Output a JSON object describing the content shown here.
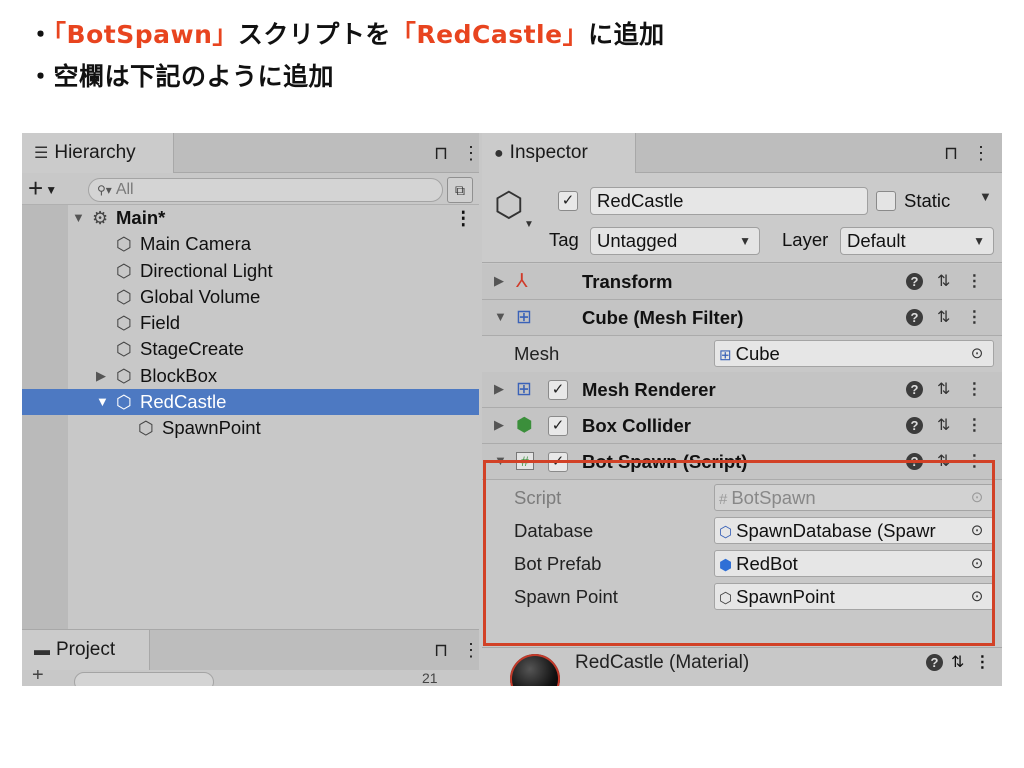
{
  "instructions": {
    "line1": {
      "bullet": "・",
      "part1": "「BotSpawn」",
      "part2": "スクリプトを",
      "part3": "「RedCastle」",
      "part4": "に追加"
    },
    "line2": {
      "bullet": "・",
      "text": "空欄は下記のように追加"
    },
    "highlight_color": "#e8441f"
  },
  "hierarchy": {
    "tab_icon": "list-icon",
    "tab_label": "Hierarchy",
    "lock_glyph": "⊓",
    "menu_glyph": "⋮",
    "add_glyph": "+",
    "search_placeholder": "All",
    "items": [
      {
        "label": "Main*",
        "indent": 0,
        "expanded": true,
        "icon": "unity-scene-icon",
        "bold": true,
        "selected": false
      },
      {
        "label": "Main Camera",
        "indent": 1,
        "icon": "cube-icon",
        "selected": false
      },
      {
        "label": "Directional Light",
        "indent": 1,
        "icon": "cube-icon",
        "selected": false
      },
      {
        "label": "Global Volume",
        "indent": 1,
        "icon": "cube-icon",
        "selected": false
      },
      {
        "label": "Field",
        "indent": 1,
        "icon": "cube-icon",
        "selected": false
      },
      {
        "label": "StageCreate",
        "indent": 1,
        "icon": "cube-icon",
        "selected": false
      },
      {
        "label": "BlockBox",
        "indent": 1,
        "collapsed": true,
        "icon": "cube-icon",
        "selected": false
      },
      {
        "label": "RedCastle",
        "indent": 1,
        "expanded": true,
        "icon": "cube-icon",
        "selected": true
      },
      {
        "label": "SpawnPoint",
        "indent": 2,
        "icon": "cube-icon",
        "selected": false
      }
    ],
    "selection_color": "#4d79c2"
  },
  "project": {
    "tab_label": "Project",
    "tab_icon": "folder-icon",
    "count": "21"
  },
  "inspector": {
    "tab_label": "Inspector",
    "tab_icon": "info-icon",
    "object_name": "RedCastle",
    "active": true,
    "static_label": "Static",
    "static_checked": false,
    "tag_label": "Tag",
    "tag_value": "Untagged",
    "layer_label": "Layer",
    "layer_value": "Default",
    "components": [
      {
        "title": "Transform",
        "expanded": false,
        "icon": "transform-icon",
        "has_checkbox": false
      },
      {
        "title": "Cube (Mesh Filter)",
        "expanded": true,
        "icon": "mesh-filter-icon",
        "has_checkbox": false,
        "properties": [
          {
            "label": "Mesh",
            "value": "Cube",
            "icon": "mesh-icon"
          }
        ]
      },
      {
        "title": "Mesh Renderer",
        "expanded": false,
        "icon": "mesh-renderer-icon",
        "has_checkbox": true,
        "checked": true
      },
      {
        "title": "Box Collider",
        "expanded": false,
        "icon": "box-collider-icon",
        "has_checkbox": true,
        "checked": true
      },
      {
        "title": "Bot Spawn (Script)",
        "expanded": true,
        "icon": "script-icon",
        "has_checkbox": true,
        "checked": true,
        "properties": [
          {
            "label": "Script",
            "value": "BotSpawn",
            "icon": "script-icon",
            "disabled": true
          },
          {
            "label": "Database",
            "value": "SpawnDatabase (Spawr",
            "icon": "scriptable-object-icon"
          },
          {
            "label": "Bot Prefab",
            "value": "RedBot",
            "icon": "prefab-icon"
          },
          {
            "label": "Spawn Point",
            "value": "SpawnPoint",
            "icon": "cube-icon"
          }
        ]
      }
    ],
    "material": {
      "title": "RedCastle (Material)",
      "icon": "material-sphere-icon"
    },
    "help_glyph": "?",
    "settings_glyph": "⇅",
    "menu_glyph": "⋮",
    "target_glyph": "⊙",
    "highlight_box_color": "#d24126"
  }
}
